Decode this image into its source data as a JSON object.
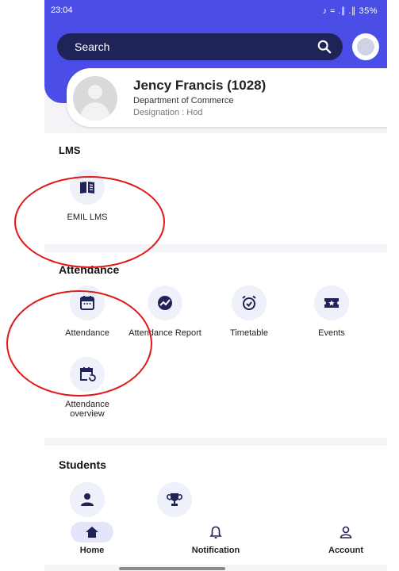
{
  "status_bar": {
    "time": "23:04",
    "indicators": "♪ ≈ .∥ .∥ 35%",
    "battery": "35%"
  },
  "search": {
    "placeholder": "Search"
  },
  "profile": {
    "name": "Jency Francis (1028)",
    "department": "Department of Commerce",
    "designation": "Designation : Hod"
  },
  "sections": {
    "lms": {
      "title": "LMS",
      "items": [
        {
          "label": "EMIL LMS",
          "icon": "book-icon"
        }
      ]
    },
    "attendance": {
      "title": "Attendance",
      "items": [
        {
          "label": "Attendance",
          "icon": "calendar-icon"
        },
        {
          "label": "Attendance Report",
          "icon": "chart-icon"
        },
        {
          "label": "Timetable",
          "icon": "alarm-clock-icon"
        },
        {
          "label": "Events",
          "icon": "ticket-icon"
        },
        {
          "label": "Attendance overview",
          "icon": "calendar-refresh-icon"
        }
      ]
    },
    "students": {
      "title": "Students",
      "items": [
        {
          "icon": "person-icon"
        },
        {
          "icon": "trophy-icon"
        }
      ]
    }
  },
  "nav": {
    "home": "Home",
    "notification": "Notification",
    "account": "Account"
  },
  "colors": {
    "header": "#4b4ee6",
    "search_bg": "#1f2357",
    "tile_bg": "#eef0fa",
    "icon": "#1f2357",
    "annotation": "#e01818"
  }
}
